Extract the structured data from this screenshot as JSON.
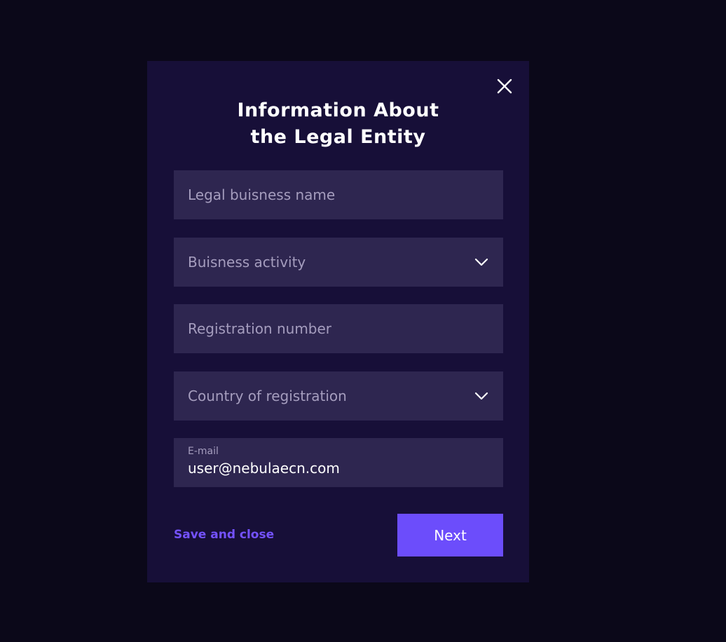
{
  "modal": {
    "title_line1": "Information About",
    "title_line2": "the Legal Entity",
    "close_icon": "close-icon"
  },
  "form": {
    "legal_business_name": {
      "placeholder": "Legal buisness name",
      "value": ""
    },
    "business_activity": {
      "placeholder": "Buisness activity",
      "icon": "chevron-down-icon"
    },
    "registration_number": {
      "placeholder": "Registration number",
      "value": ""
    },
    "country_of_registration": {
      "placeholder": "Country of registration",
      "icon": "chevron-down-icon"
    },
    "email": {
      "label": "E-mail",
      "value": "user@nebulaecn.com"
    }
  },
  "actions": {
    "save_label": "Save and close",
    "next_label": "Next"
  },
  "colors": {
    "background": "#0b0819",
    "modal": "#170f38",
    "field": "#2e2650",
    "accent": "#6c4dfb",
    "link": "#7452ff"
  }
}
